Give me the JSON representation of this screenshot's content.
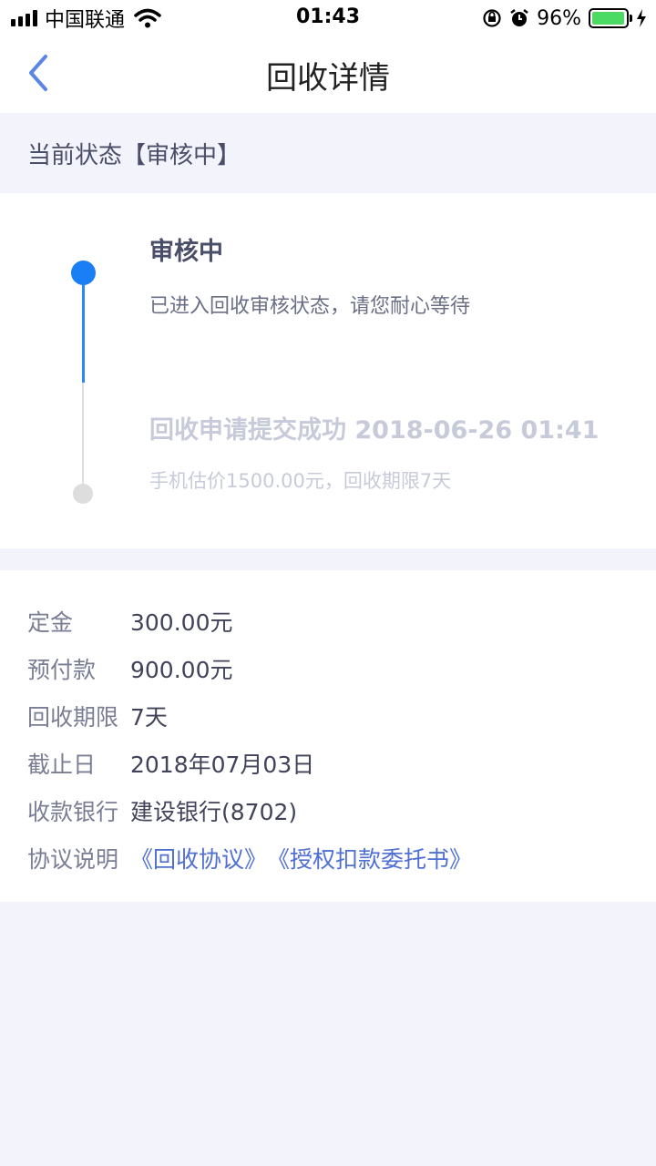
{
  "status_bar": {
    "carrier": "中国联通",
    "time": "01:43",
    "battery_percent": "96%",
    "battery_level": 0.96,
    "icons": [
      "signal-icon",
      "wifi-icon",
      "orientation-lock-icon",
      "alarm-icon",
      "battery-icon",
      "charging-icon"
    ]
  },
  "nav": {
    "title": "回收详情",
    "back_icon": "chevron-left-icon"
  },
  "current_status": {
    "text": "当前状态【审核中】"
  },
  "timeline": {
    "steps": [
      {
        "title": "审核中",
        "desc": "已进入回收审核状态，请您耐心等待",
        "active": true
      },
      {
        "title": "回收申请提交成功 2018-06-26 01:41",
        "desc": "手机估价1500.00元，回收期限7天",
        "active": false
      }
    ]
  },
  "details": {
    "rows": [
      {
        "label": "定金",
        "value": "300.00元"
      },
      {
        "label": "预付款",
        "value": "900.00元"
      },
      {
        "label": "回收期限",
        "value": "7天"
      },
      {
        "label": "截止日",
        "value": "2018年07月03日"
      },
      {
        "label": "收款银行",
        "value": "建设银行(8702)"
      },
      {
        "label": "协议说明",
        "links": [
          "《回收协议》",
          "《授权扣款委托书》"
        ]
      }
    ]
  },
  "colors": {
    "accent": "#1a7ff5",
    "link": "#4f6fd3",
    "background": "#f2f3fb",
    "battery": "#4cd964"
  }
}
